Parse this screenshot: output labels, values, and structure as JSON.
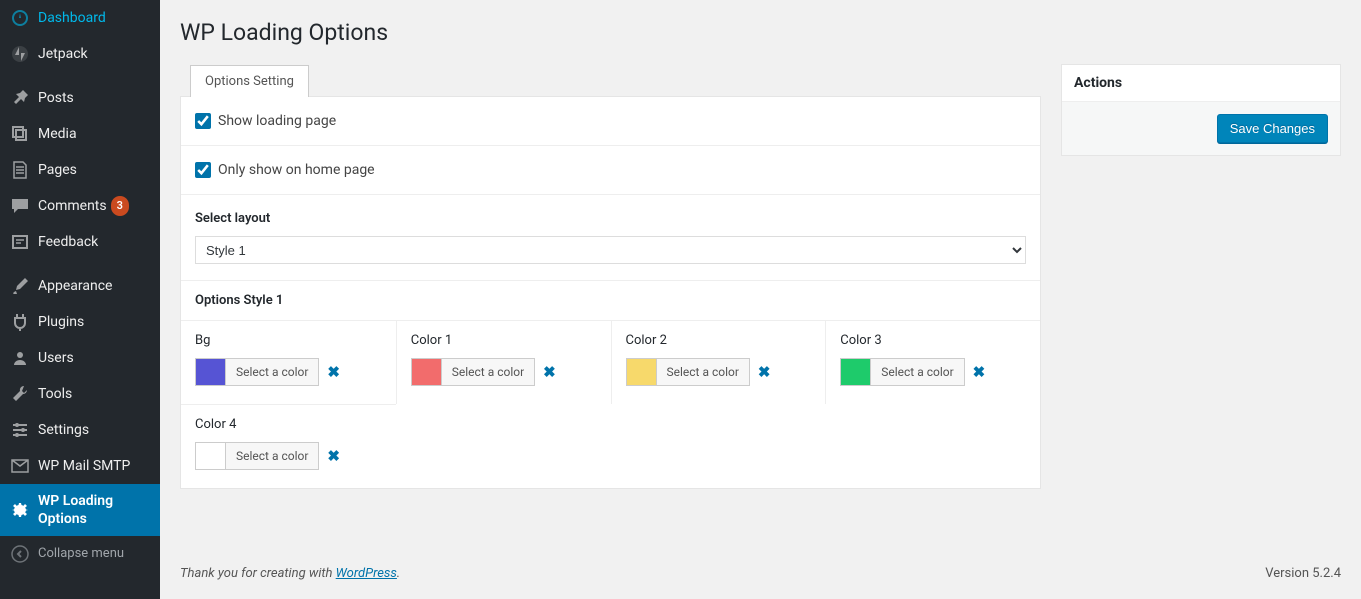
{
  "sidebar": {
    "items": [
      {
        "label": "Dashboard",
        "icon": "dashboard"
      },
      {
        "label": "Jetpack",
        "icon": "jetpack"
      },
      {
        "label": "Posts",
        "icon": "posts"
      },
      {
        "label": "Media",
        "icon": "media"
      },
      {
        "label": "Pages",
        "icon": "pages"
      },
      {
        "label": "Comments",
        "icon": "comments",
        "badge": "3"
      },
      {
        "label": "Feedback",
        "icon": "feedback"
      },
      {
        "label": "Appearance",
        "icon": "appearance"
      },
      {
        "label": "Plugins",
        "icon": "plugins"
      },
      {
        "label": "Users",
        "icon": "users"
      },
      {
        "label": "Tools",
        "icon": "tools"
      },
      {
        "label": "Settings",
        "icon": "settings"
      },
      {
        "label": "WP Mail SMTP",
        "icon": "mail"
      },
      {
        "label": "WP Loading Options",
        "icon": "gear",
        "current": true
      }
    ],
    "collapse": "Collapse menu"
  },
  "page": {
    "title": "WP Loading Options",
    "tab": "Options Setting",
    "show_loading_label": "Show loading page",
    "only_home_label": "Only show on home page",
    "show_loading_checked": true,
    "only_home_checked": true,
    "select_layout_label": "Select layout",
    "select_layout_value": "Style 1",
    "options_style_title": "Options Style 1",
    "select_color_label": "Select a color",
    "colors": [
      {
        "name": "Bg",
        "swatch": "#5654d4"
      },
      {
        "name": "Color 1",
        "swatch": "#f26c6c"
      },
      {
        "name": "Color 2",
        "swatch": "#f7d96b"
      },
      {
        "name": "Color 3",
        "swatch": "#1ecb6b"
      },
      {
        "name": "Color 4",
        "swatch": "#ffffff"
      }
    ]
  },
  "actions": {
    "title": "Actions",
    "save": "Save Changes"
  },
  "footer": {
    "thanks_prefix": "Thank you for creating with ",
    "wp_link": "WordPress",
    "thanks_suffix": ".",
    "version": "Version 5.2.4"
  }
}
